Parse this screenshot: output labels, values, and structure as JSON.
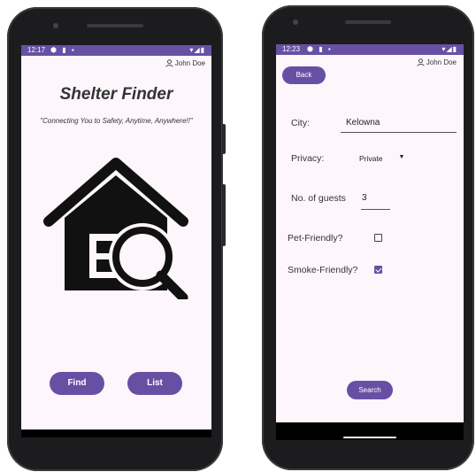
{
  "colors": {
    "accent": "#6750a4",
    "screen_bg": "#fdf6fb",
    "phone": "#1c1c1e"
  },
  "left_screen": {
    "status": {
      "time": "12:17",
      "left_icons": "⬢ ▮ ▪",
      "right_icons": "▾◢▮"
    },
    "user": {
      "icon": "person-icon",
      "name": "John Doe"
    },
    "title": "Shelter Finder",
    "tagline": "\"Connecting You to Safety, Anytime, Anywhere!!\"",
    "logo_icon": "house-search-icon",
    "find_label": "Find",
    "list_label": "List"
  },
  "right_screen": {
    "status": {
      "time": "12:23",
      "left_icons": "⬢ ▮ ▪",
      "right_icons": "▾◢▮"
    },
    "back_label": "Back",
    "user": {
      "icon": "person-icon",
      "name": "John Doe"
    },
    "city": {
      "label": "City:",
      "value": "Kelowna"
    },
    "privacy": {
      "label": "Privacy:",
      "value": "Private"
    },
    "guests": {
      "label": "No. of guests",
      "value": "3"
    },
    "pet": {
      "label": "Pet-Friendly?",
      "checked": false
    },
    "smoke": {
      "label": "Smoke-Friendly?",
      "checked": true
    },
    "search_label": "Search"
  }
}
